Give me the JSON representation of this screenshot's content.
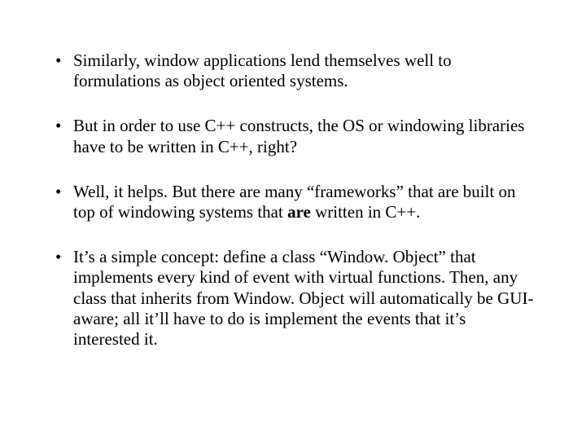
{
  "bullets": {
    "b1": "Similarly, window applications lend themselves well to formulations as object oriented systems.",
    "b2": "But in order to use C++ constructs, the OS or windowing libraries have to be written in C++, right?",
    "b3a": "Well, it helps.  But there are many “frameworks” that are built on top of windowing systems that ",
    "b3_bold": "are",
    "b3b": " written in C++.",
    "b4": "It’s a simple concept:  define a class “Window. Object” that implements every kind of event with virtual functions.  Then, any class that inherits from Window. Object will automatically be GUI-aware;  all it’ll have to do is implement the events that it’s interested it."
  }
}
